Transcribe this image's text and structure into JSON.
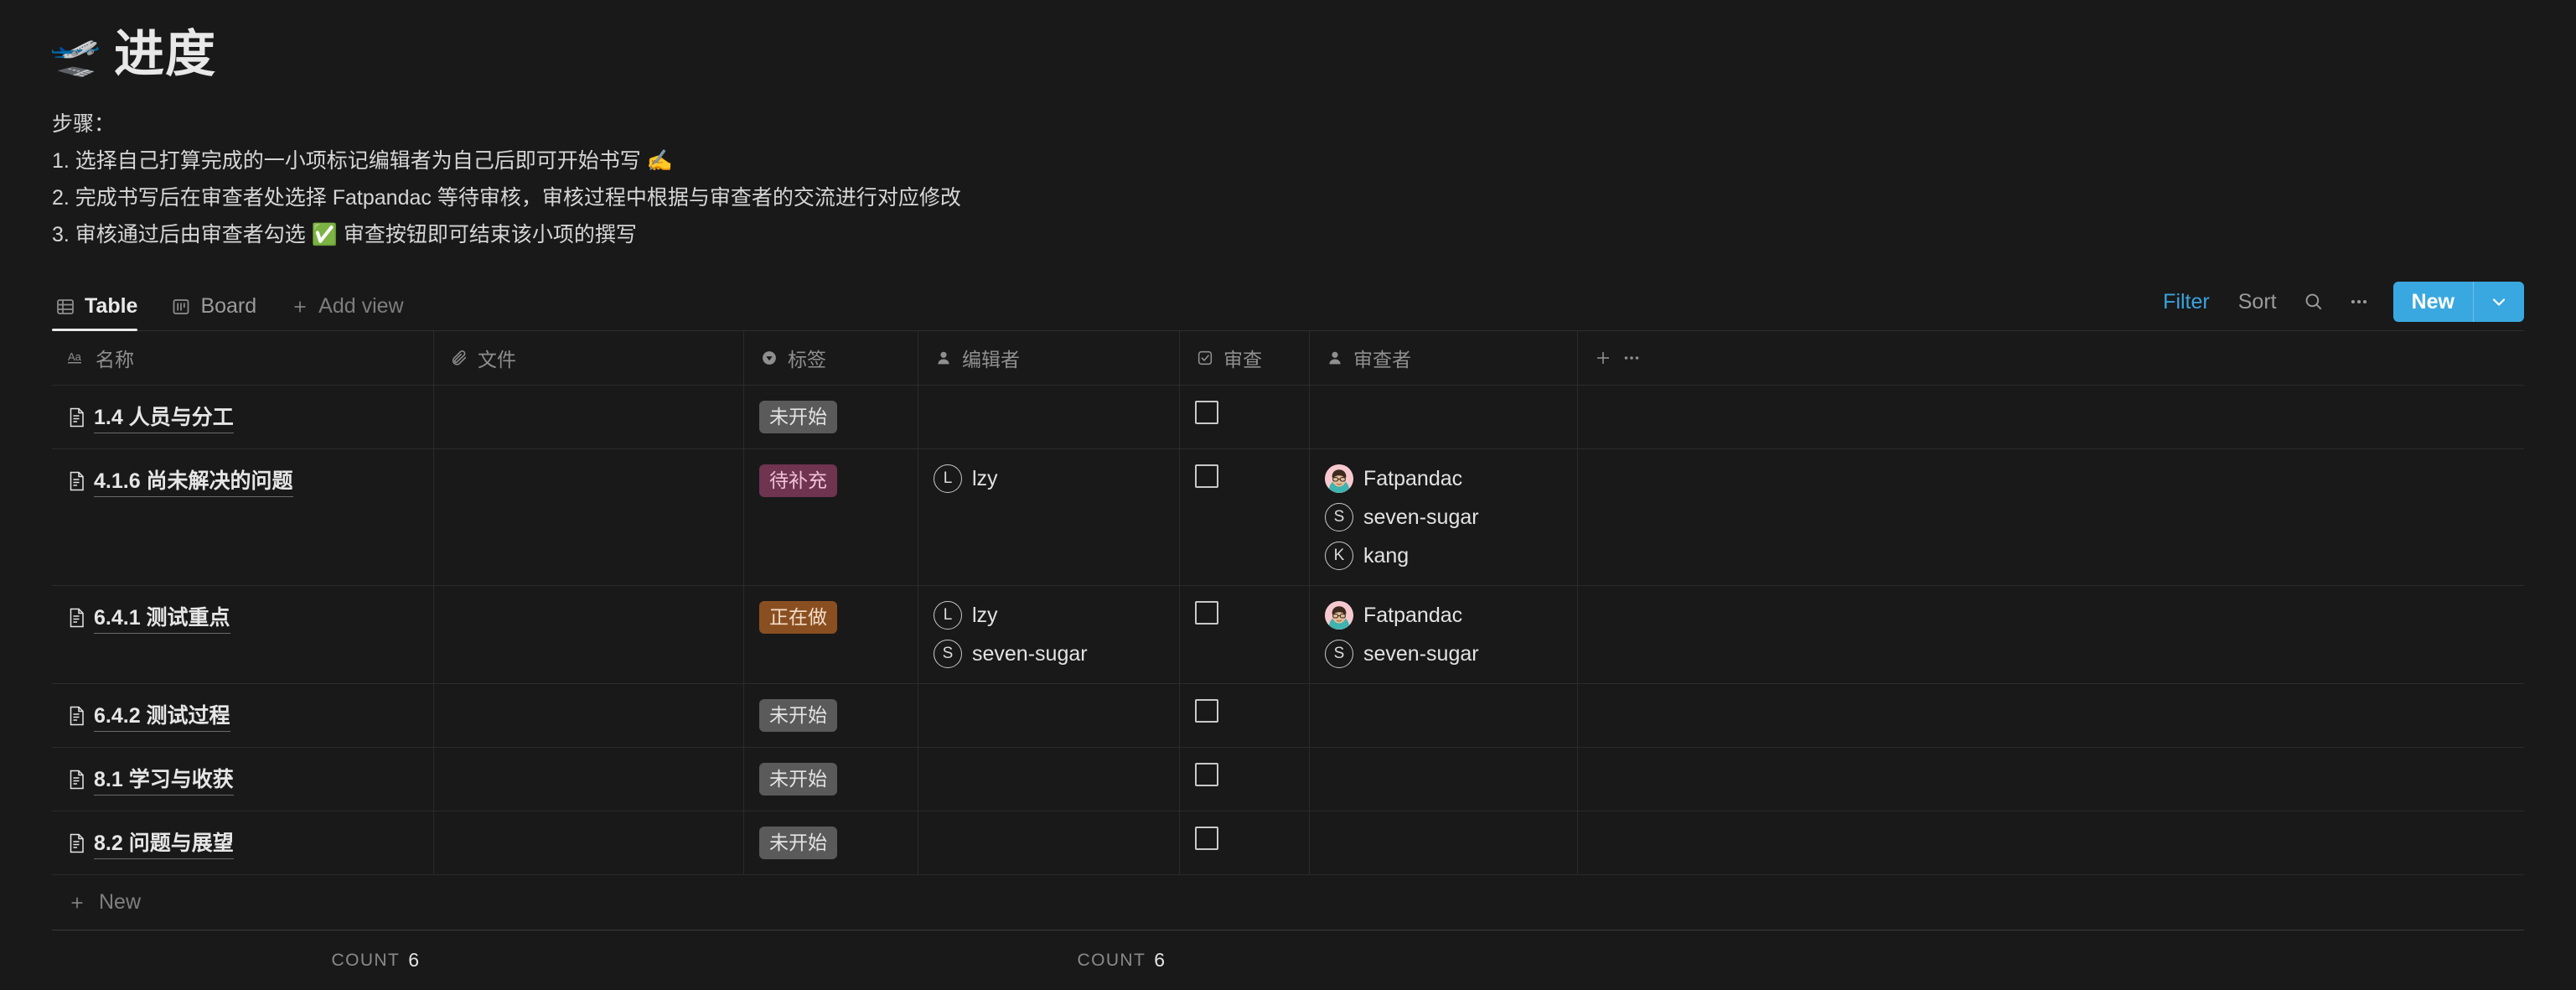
{
  "header": {
    "emoji": "🛫",
    "emoji_name": "airplane-departure-emoji",
    "title": "进度",
    "steps_label": "步骤：",
    "steps": [
      "1. 选择自己打算完成的一小项标记编辑者为自己后即可开始书写 ✍️",
      "2. 完成书写后在审查者处选择 Fatpandac 等待审核，审核过程中根据与审查者的交流进行对应修改",
      "3. 审核通过后由审查者勾选 ✅ 审查按钮即可结束该小项的撰写"
    ]
  },
  "toolbar": {
    "views": [
      {
        "label": "Table",
        "icon": "table-icon",
        "active": true
      },
      {
        "label": "Board",
        "icon": "board-icon",
        "active": false
      }
    ],
    "add_view_label": "Add view",
    "filter_label": "Filter",
    "sort_label": "Sort",
    "search_icon": "search-icon",
    "more_icon": "more-horizontal-icon",
    "new_label": "New",
    "new_chevron_icon": "chevron-down-icon",
    "accent_color": "#3aa8e0",
    "filter_active_color": "#3aa3dd"
  },
  "table": {
    "columns": [
      {
        "label": "名称",
        "icon": "title-text-icon"
      },
      {
        "label": "文件",
        "icon": "paperclip-icon"
      },
      {
        "label": "标签",
        "icon": "select-dropdown-icon"
      },
      {
        "label": "编辑者",
        "icon": "person-icon"
      },
      {
        "label": "审查",
        "icon": "checkbox-icon"
      },
      {
        "label": "审查者",
        "icon": "person-icon"
      }
    ],
    "add_column_icon": "plus-icon",
    "column_options_icon": "more-horizontal-icon",
    "rows": [
      {
        "name": "1.4 人员与分工",
        "file": "",
        "tag": {
          "label": "未开始",
          "color": "gray"
        },
        "editors": [],
        "checked": false,
        "reviewers": []
      },
      {
        "name": "4.1.6 尚未解决的问题",
        "file": "",
        "tag": {
          "label": "待补充",
          "color": "pink"
        },
        "editors": [
          {
            "name": "lzy",
            "initial": "L",
            "avatar": "letter"
          }
        ],
        "checked": false,
        "reviewers": [
          {
            "name": "Fatpandac",
            "initial": "F",
            "avatar": "photo"
          },
          {
            "name": "seven-sugar",
            "initial": "S",
            "avatar": "letter"
          },
          {
            "name": "kang",
            "initial": "K",
            "avatar": "letter"
          }
        ]
      },
      {
        "name": "6.4.1 测试重点",
        "file": "",
        "tag": {
          "label": "正在做",
          "color": "orange"
        },
        "editors": [
          {
            "name": "lzy",
            "initial": "L",
            "avatar": "letter"
          },
          {
            "name": "seven-sugar",
            "initial": "S",
            "avatar": "letter"
          }
        ],
        "checked": false,
        "reviewers": [
          {
            "name": "Fatpandac",
            "initial": "F",
            "avatar": "photo"
          },
          {
            "name": "seven-sugar",
            "initial": "S",
            "avatar": "letter"
          }
        ]
      },
      {
        "name": "6.4.2 测试过程",
        "file": "",
        "tag": {
          "label": "未开始",
          "color": "gray"
        },
        "editors": [],
        "checked": false,
        "reviewers": []
      },
      {
        "name": "8.1 学习与收获",
        "file": "",
        "tag": {
          "label": "未开始",
          "color": "gray"
        },
        "editors": [],
        "checked": false,
        "reviewers": []
      },
      {
        "name": "8.2 问题与展望",
        "file": "",
        "tag": {
          "label": "未开始",
          "color": "gray"
        },
        "editors": [],
        "checked": false,
        "reviewers": []
      }
    ],
    "new_row_label": "New",
    "new_row_icon": "plus-icon",
    "aggregations": [
      {
        "column": "名称",
        "label": "COUNT",
        "value": "6"
      },
      {
        "column": "编辑者",
        "label": "COUNT",
        "value": "6"
      }
    ]
  },
  "tag_colors": {
    "gray": "#5a5a5a",
    "pink": "#6e3450",
    "orange": "#8a4f21"
  }
}
